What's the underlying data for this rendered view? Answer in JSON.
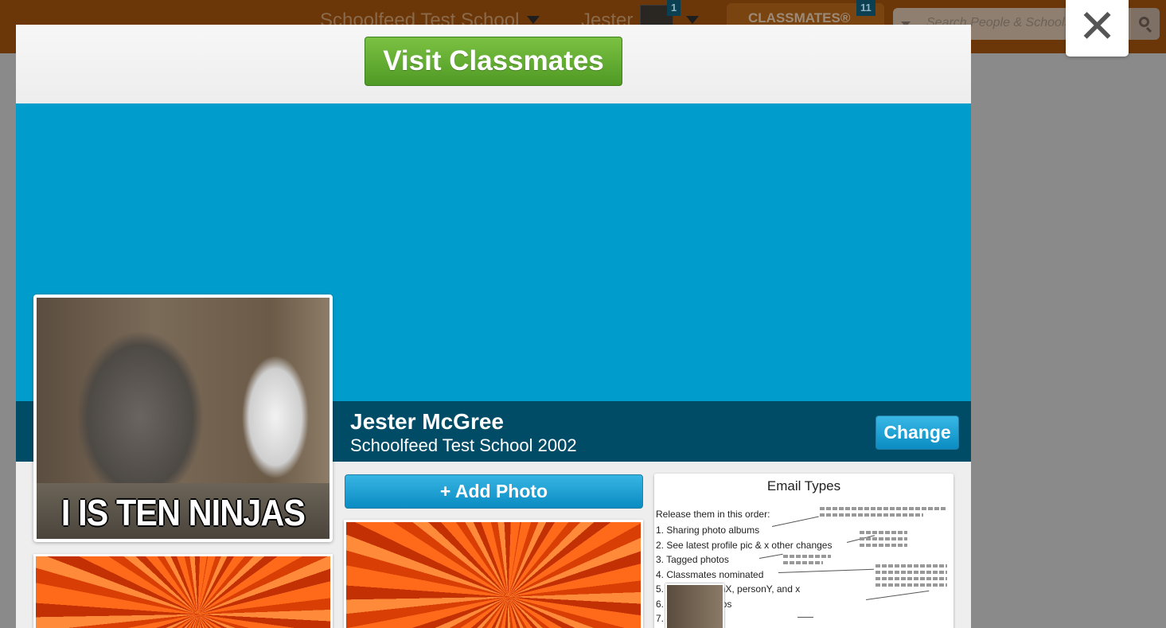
{
  "topbar": {
    "school_name": "Schoolfeed Test School",
    "user_name": "Jester",
    "notification_count": "1",
    "classmates_label": "CLASSMATES®",
    "classmates_count": "11",
    "search_placeholder": "Search People & Schools"
  },
  "modal": {
    "visit_button": "Visit Classmates",
    "profile": {
      "name": "Jester McGree",
      "school_year": "Schoolfeed Test School 2002",
      "change_button": "Change",
      "profile_caption": "I IS TEN NINJAS"
    },
    "add_photo_button": "+ Add Photo",
    "email_card": {
      "title": "Email Types",
      "intro": "Release them in this order:",
      "items": [
        "1.  Sharing photo albums",
        "2.  See latest profile pic & x other changes",
        "3.  Tagged photos",
        "4.  Classmates nominated",
        "5.                    ember personX, personY, and x",
        "6.                    ominate photos",
        "7.                    ked for ..."
      ]
    }
  },
  "close_icon": "close-icon",
  "colors": {
    "cover": "#009dcc",
    "name_band": "#004c66",
    "visit_green": "#5fa832",
    "button_blue": "#1a9bd1"
  }
}
